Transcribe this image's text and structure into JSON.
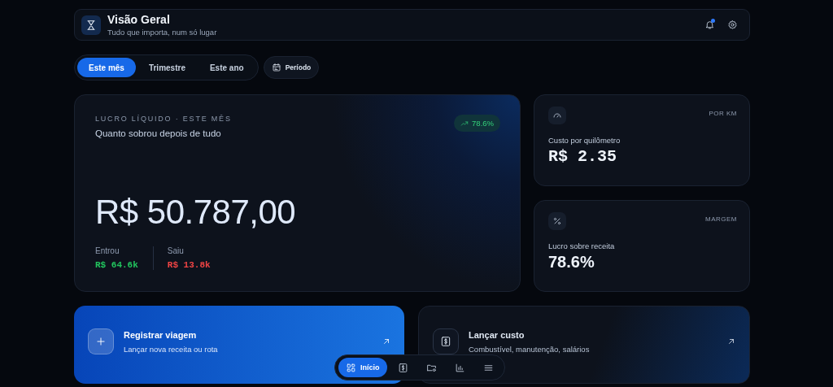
{
  "header": {
    "title": "Visão Geral",
    "subtitle": "Tudo que importa, num só lugar",
    "notification": true
  },
  "period_tabs": [
    {
      "label": "Este mês",
      "selected": true
    },
    {
      "label": "Trimestre",
      "selected": false
    },
    {
      "label": "Este ano",
      "selected": false
    }
  ],
  "period_button": {
    "label": "Período"
  },
  "profit_card": {
    "eyebrow": "LUCRO LÍQUIDO · ESTE MÊS",
    "subtitle": "Quanto sobrou depois de tudo",
    "badge": "78.6%",
    "amount": "R$ 50.787,00",
    "flows": [
      {
        "label": "Entrou",
        "value": "R$ 64.6k",
        "color": "#22c55e"
      },
      {
        "label": "Saiu",
        "value": "R$ 13.8k",
        "color": "#ef4444"
      }
    ]
  },
  "stat_cards": [
    {
      "kind": "cost",
      "tag": "POR KM",
      "label": "Custo por quilômetro",
      "value": "R$ 2.35"
    },
    {
      "kind": "margin",
      "tag": "MARGEM",
      "label": "Lucro sobre receita",
      "value": "78.6%"
    }
  ],
  "action_cards": [
    {
      "kind": "primary",
      "title": "Registrar viagem",
      "subtitle": "Lançar nova receita ou rota"
    },
    {
      "kind": "secondary",
      "title": "Lançar custo",
      "subtitle": "Combustível, manutenção, salários"
    }
  ],
  "bottom_nav": [
    {
      "kind": "home",
      "label": "Início",
      "selected": true
    },
    {
      "kind": "finance",
      "selected": false
    },
    {
      "kind": "files",
      "selected": false
    },
    {
      "kind": "reports",
      "selected": false
    },
    {
      "kind": "more",
      "selected": false
    }
  ]
}
